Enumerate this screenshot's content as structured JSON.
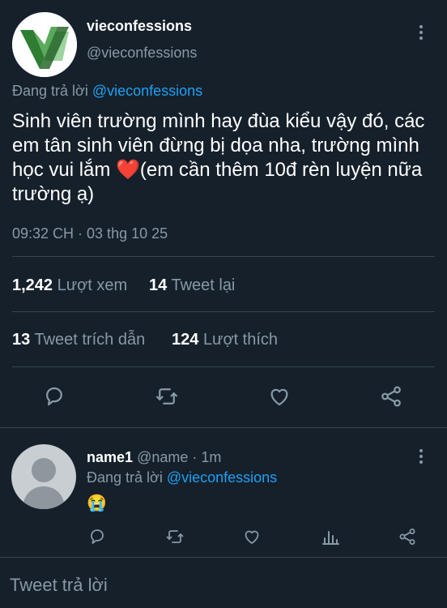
{
  "tweet": {
    "author_name": "vieconfessions",
    "author_handle": "@vieconfessions",
    "replying_prefix": "Đang trả lời ",
    "replying_to": "@vieconfessions",
    "text": "Sinh viên trường mình hay đùa kiểu vậy đó, các em tân sinh viên đừng bị dọa nha, trường mình học vui lắm ❤️(em cần thêm 10đ rèn luyện nữa trường ạ)",
    "timestamp": "09:32 CH · 03 thg 10 25"
  },
  "stats": {
    "views_count": "1,242",
    "views_label": "Lượt xem",
    "retweets_count": "14",
    "retweets_label": "Tweet lại",
    "quotes_count": "13",
    "quotes_label": "Tweet trích dẫn",
    "likes_count": "124",
    "likes_label": "Lượt thích"
  },
  "reply": {
    "author_name": "name1",
    "author_handle": "@name",
    "time": "· 1m",
    "replying_prefix": "Đang trả lời ",
    "replying_to": "@vieconfessions",
    "text": "😭"
  },
  "composer": {
    "placeholder": "Tweet trả lời"
  },
  "icons": {
    "reply": "reply-icon",
    "retweet": "retweet-icon",
    "like": "heart-icon",
    "share": "share-icon",
    "analytics": "analytics-icon",
    "more": "more-icon"
  },
  "colors": {
    "background": "#15202b",
    "muted": "#8899a6",
    "link": "#1da1f2",
    "divider": "#38444d",
    "logo_green": "#2e7d32"
  }
}
